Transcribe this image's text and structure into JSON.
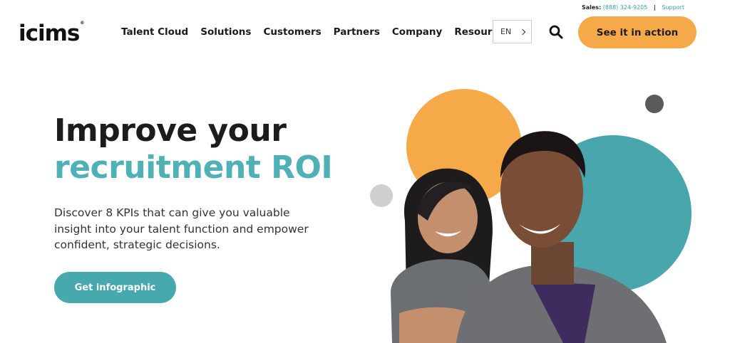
{
  "utility": {
    "sales_label": "Sales:",
    "phone": "(888) 324-9205",
    "divider": "|",
    "support": "Support"
  },
  "header": {
    "logo": "icims",
    "nav": [
      "Talent Cloud",
      "Solutions",
      "Customers",
      "Partners",
      "Company",
      "Resources"
    ],
    "language": "EN",
    "cta": "See it in action"
  },
  "hero": {
    "title_line1": "Improve your",
    "title_line2": "recruitment ROI",
    "description": "Discover 8 KPIs that can give you valuable insight into your talent function and empower confident, strategic decisions.",
    "button": "Get infographic"
  },
  "colors": {
    "accent_teal": "#4fb0b6",
    "accent_orange": "#f6a948",
    "dark": "#1c1c1c"
  },
  "icons": [
    "search-icon",
    "chevron-right-icon"
  ]
}
